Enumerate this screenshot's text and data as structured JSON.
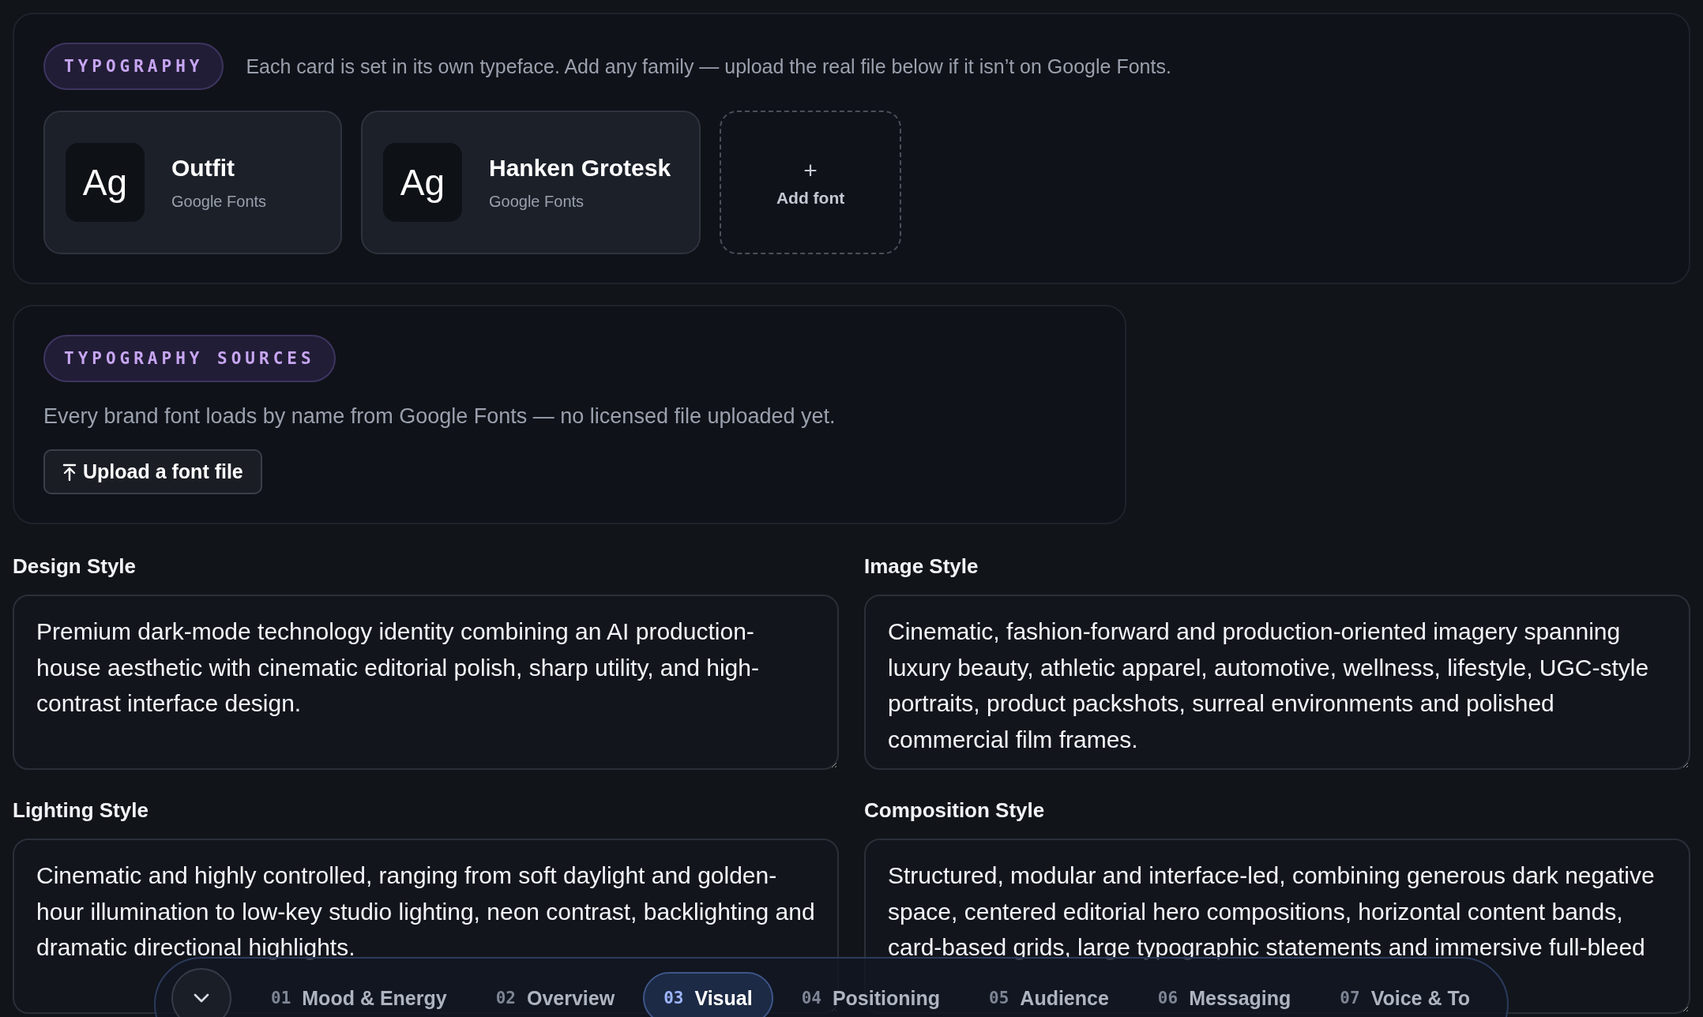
{
  "typography": {
    "badge": "TYPOGRAPHY",
    "description": "Each card is set in its own typeface. Add any family — upload the real file below if it isn’t on Google Fonts.",
    "fonts": [
      {
        "sample": "Ag",
        "name": "Outfit",
        "source": "Google Fonts"
      },
      {
        "sample": "Ag",
        "name": "Hanken Grotesk",
        "source": "Google Fonts"
      }
    ],
    "add": {
      "icon": "+",
      "label": "Add font"
    }
  },
  "sources": {
    "badge": "TYPOGRAPHY SOURCES",
    "description": "Every brand font loads by name from Google Fonts — no licensed file uploaded yet.",
    "button": "Upload a font file"
  },
  "fields": [
    {
      "label": "Design Style",
      "value": "Premium dark-mode technology identity combining an AI production-house aesthetic with cinematic editorial polish, sharp utility, and high-contrast interface design."
    },
    {
      "label": "Image Style",
      "value": "Cinematic, fashion-forward and production-oriented imagery spanning luxury beauty, athletic apparel, automotive, wellness, lifestyle, UGC-style portraits, product packshots, surreal environments and polished commercial film frames."
    },
    {
      "label": "Lighting Style",
      "value": "Cinematic and highly controlled, ranging from soft daylight and golden-hour illumination to low-key studio lighting, neon contrast, backlighting and dramatic directional highlights."
    },
    {
      "label": "Composition Style",
      "value": "Structured, modular and interface-led, combining generous dark negative space, centered editorial hero compositions, horizontal content bands, card-based grids, large typographic statements and immersive full-bleed"
    }
  ],
  "nav": [
    {
      "number": "01",
      "label": "Mood & Energy",
      "selected": false
    },
    {
      "number": "02",
      "label": "Overview",
      "selected": false
    },
    {
      "number": "03",
      "label": "Visual",
      "selected": true
    },
    {
      "number": "04",
      "label": "Positioning",
      "selected": false
    },
    {
      "number": "05",
      "label": "Audience",
      "selected": false
    },
    {
      "number": "06",
      "label": "Messaging",
      "selected": false
    },
    {
      "number": "07",
      "label": "Voice & To",
      "selected": false
    }
  ]
}
